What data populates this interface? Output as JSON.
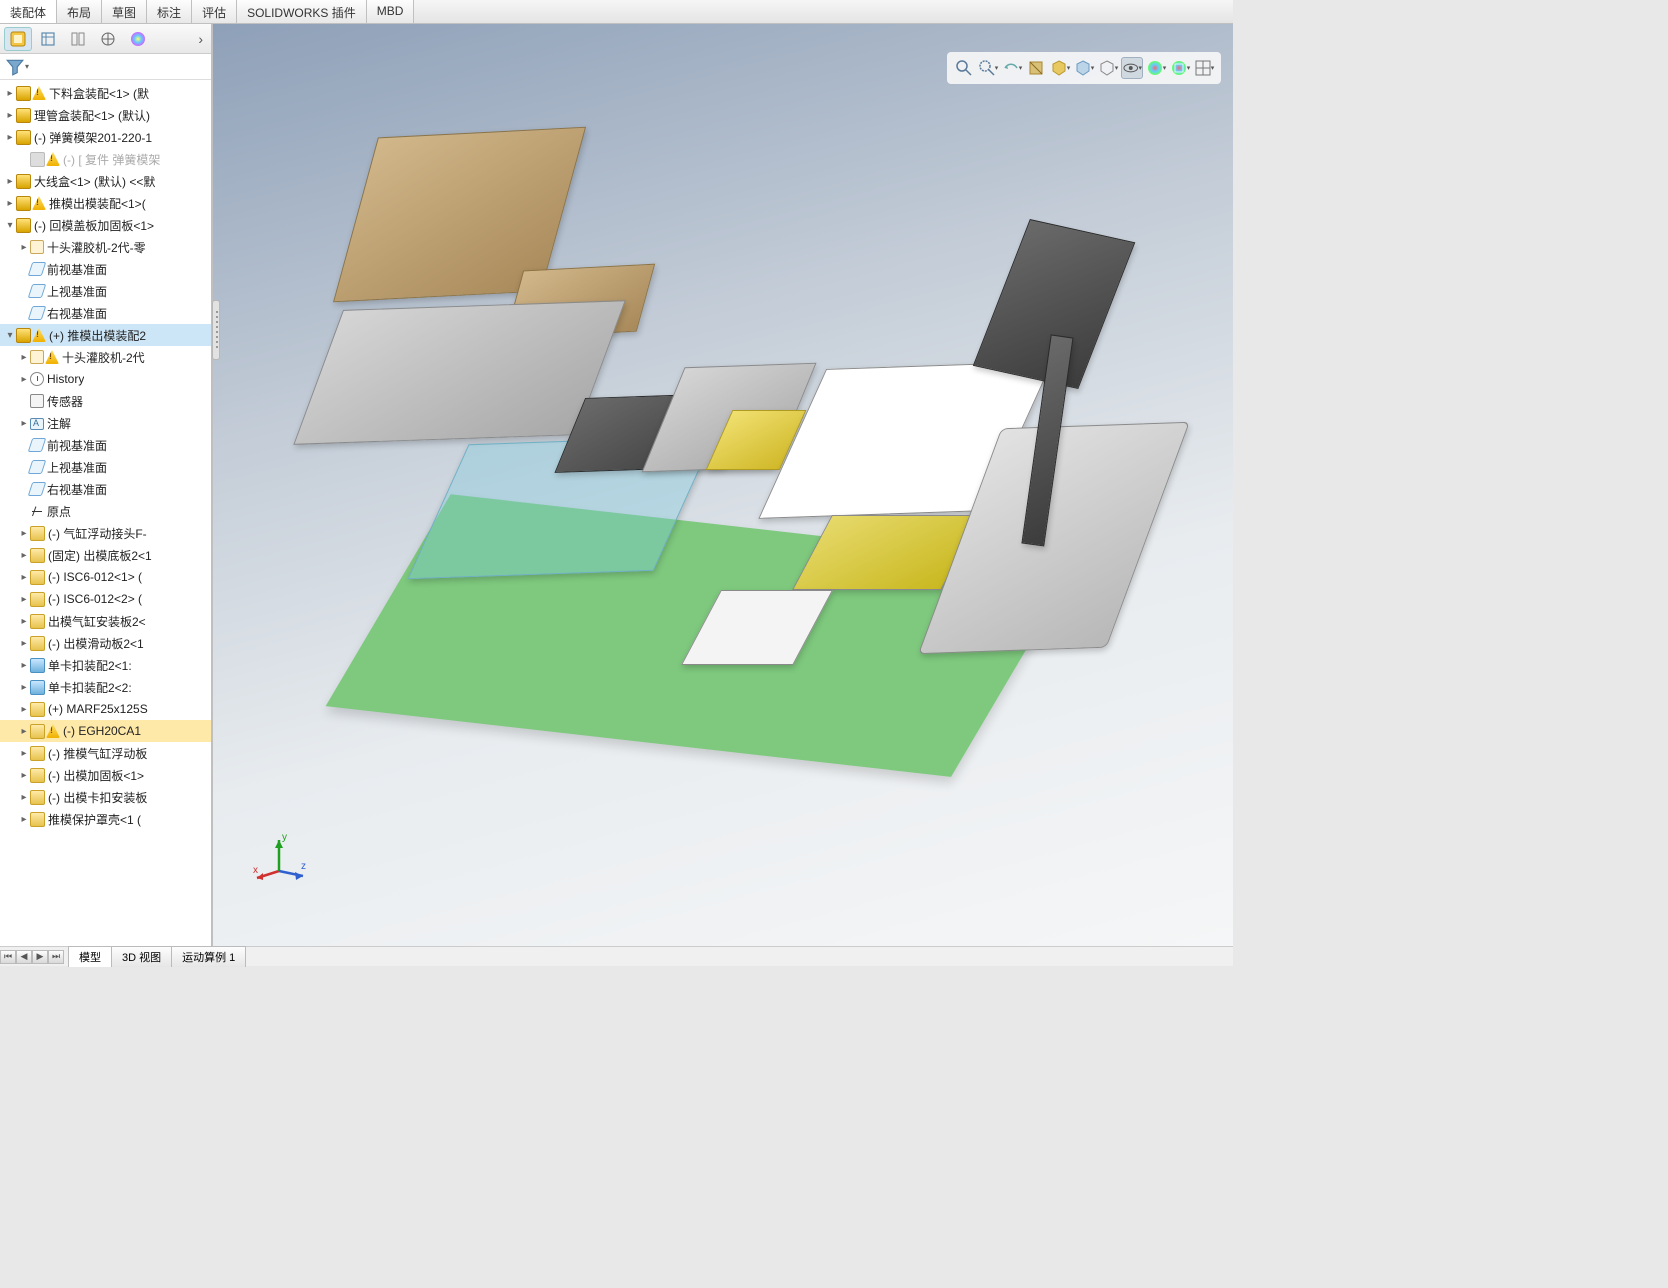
{
  "menu": {
    "tabs": [
      "装配体",
      "布局",
      "草图",
      "标注",
      "评估",
      "SOLIDWORKS 插件",
      "MBD"
    ]
  },
  "tree": {
    "items": [
      {
        "exp": "▸",
        "icons": [
          "asm",
          "warn"
        ],
        "label": "下料盒装配<1> (默",
        "indent": 0
      },
      {
        "exp": "▸",
        "icons": [
          "asm"
        ],
        "label": "理管盒装配<1> (默认)",
        "indent": 0
      },
      {
        "exp": "▸",
        "icons": [
          "asm"
        ],
        "label": "(-) 弹簧模架201-220-1",
        "indent": 0
      },
      {
        "exp": "",
        "icons": [
          "ghost",
          "warn"
        ],
        "label": "(-) [ 复件 弹簧模架",
        "indent": 1,
        "ghost": true
      },
      {
        "exp": "▸",
        "icons": [
          "asm"
        ],
        "label": "大线盒<1> (默认) <<默",
        "indent": 0
      },
      {
        "exp": "▸",
        "icons": [
          "asm",
          "warn"
        ],
        "label": "推模出模装配<1>(",
        "indent": 0
      },
      {
        "exp": "▾",
        "icons": [
          "asm"
        ],
        "label": "(-) 回模盖板加固板<1>",
        "indent": 0
      },
      {
        "exp": "▸",
        "icons": [
          "clip"
        ],
        "label": "十头灌胶机-2代-零",
        "indent": 1
      },
      {
        "exp": "",
        "icons": [
          "plane"
        ],
        "label": "前视基准面",
        "indent": 1
      },
      {
        "exp": "",
        "icons": [
          "plane"
        ],
        "label": "上视基准面",
        "indent": 1
      },
      {
        "exp": "",
        "icons": [
          "plane"
        ],
        "label": "右视基准面",
        "indent": 1
      },
      {
        "exp": "▾",
        "icons": [
          "asm",
          "warn"
        ],
        "label": "(+) 推模出模装配2",
        "indent": 0,
        "selected": true
      },
      {
        "exp": "▸",
        "icons": [
          "clip",
          "warn"
        ],
        "label": "十头灌胶机-2代",
        "indent": 1
      },
      {
        "exp": "▸",
        "icons": [
          "history"
        ],
        "label": "History",
        "indent": 1
      },
      {
        "exp": "",
        "icons": [
          "sensor"
        ],
        "label": "传感器",
        "indent": 1
      },
      {
        "exp": "▸",
        "icons": [
          "annot"
        ],
        "label": "注解",
        "indent": 1
      },
      {
        "exp": "",
        "icons": [
          "plane"
        ],
        "label": "前视基准面",
        "indent": 1
      },
      {
        "exp": "",
        "icons": [
          "plane"
        ],
        "label": "上视基准面",
        "indent": 1
      },
      {
        "exp": "",
        "icons": [
          "plane"
        ],
        "label": "右视基准面",
        "indent": 1
      },
      {
        "exp": "",
        "icons": [
          "origin"
        ],
        "label": "原点",
        "indent": 1
      },
      {
        "exp": "▸",
        "icons": [
          "part"
        ],
        "label": "(-) 气缸浮动接头F-",
        "indent": 1
      },
      {
        "exp": "▸",
        "icons": [
          "part"
        ],
        "label": "(固定) 出模底板2<1",
        "indent": 1
      },
      {
        "exp": "▸",
        "icons": [
          "part"
        ],
        "label": "(-) ISC6-012<1> (",
        "indent": 1
      },
      {
        "exp": "▸",
        "icons": [
          "part"
        ],
        "label": "(-) ISC6-012<2> (",
        "indent": 1
      },
      {
        "exp": "▸",
        "icons": [
          "part"
        ],
        "label": "出模气缸安装板2<",
        "indent": 1
      },
      {
        "exp": "▸",
        "icons": [
          "part"
        ],
        "label": "(-) 出模滑动板2<1",
        "indent": 1
      },
      {
        "exp": "▸",
        "icons": [
          "asm2"
        ],
        "label": "单卡扣装配2<1:",
        "indent": 1
      },
      {
        "exp": "▸",
        "icons": [
          "asm2"
        ],
        "label": "单卡扣装配2<2:",
        "indent": 1
      },
      {
        "exp": "▸",
        "icons": [
          "part"
        ],
        "label": "(+) MARF25x125S",
        "indent": 1
      },
      {
        "exp": "▸",
        "icons": [
          "part",
          "warn"
        ],
        "label": "(-) EGH20CA1",
        "indent": 1,
        "highlight": true
      },
      {
        "exp": "▸",
        "icons": [
          "part"
        ],
        "label": "(-) 推模气缸浮动板",
        "indent": 1
      },
      {
        "exp": "▸",
        "icons": [
          "part"
        ],
        "label": "(-) 出模加固板<1>",
        "indent": 1
      },
      {
        "exp": "▸",
        "icons": [
          "part"
        ],
        "label": "(-) 出模卡扣安装板",
        "indent": 1
      },
      {
        "exp": "▸",
        "icons": [
          "part"
        ],
        "label": "推模保护罩壳<1 (",
        "indent": 1
      }
    ]
  },
  "bottom_tabs": [
    "模型",
    "3D 视图",
    "运动算例 1"
  ],
  "triad": {
    "x": "x",
    "y": "y",
    "z": "z"
  }
}
